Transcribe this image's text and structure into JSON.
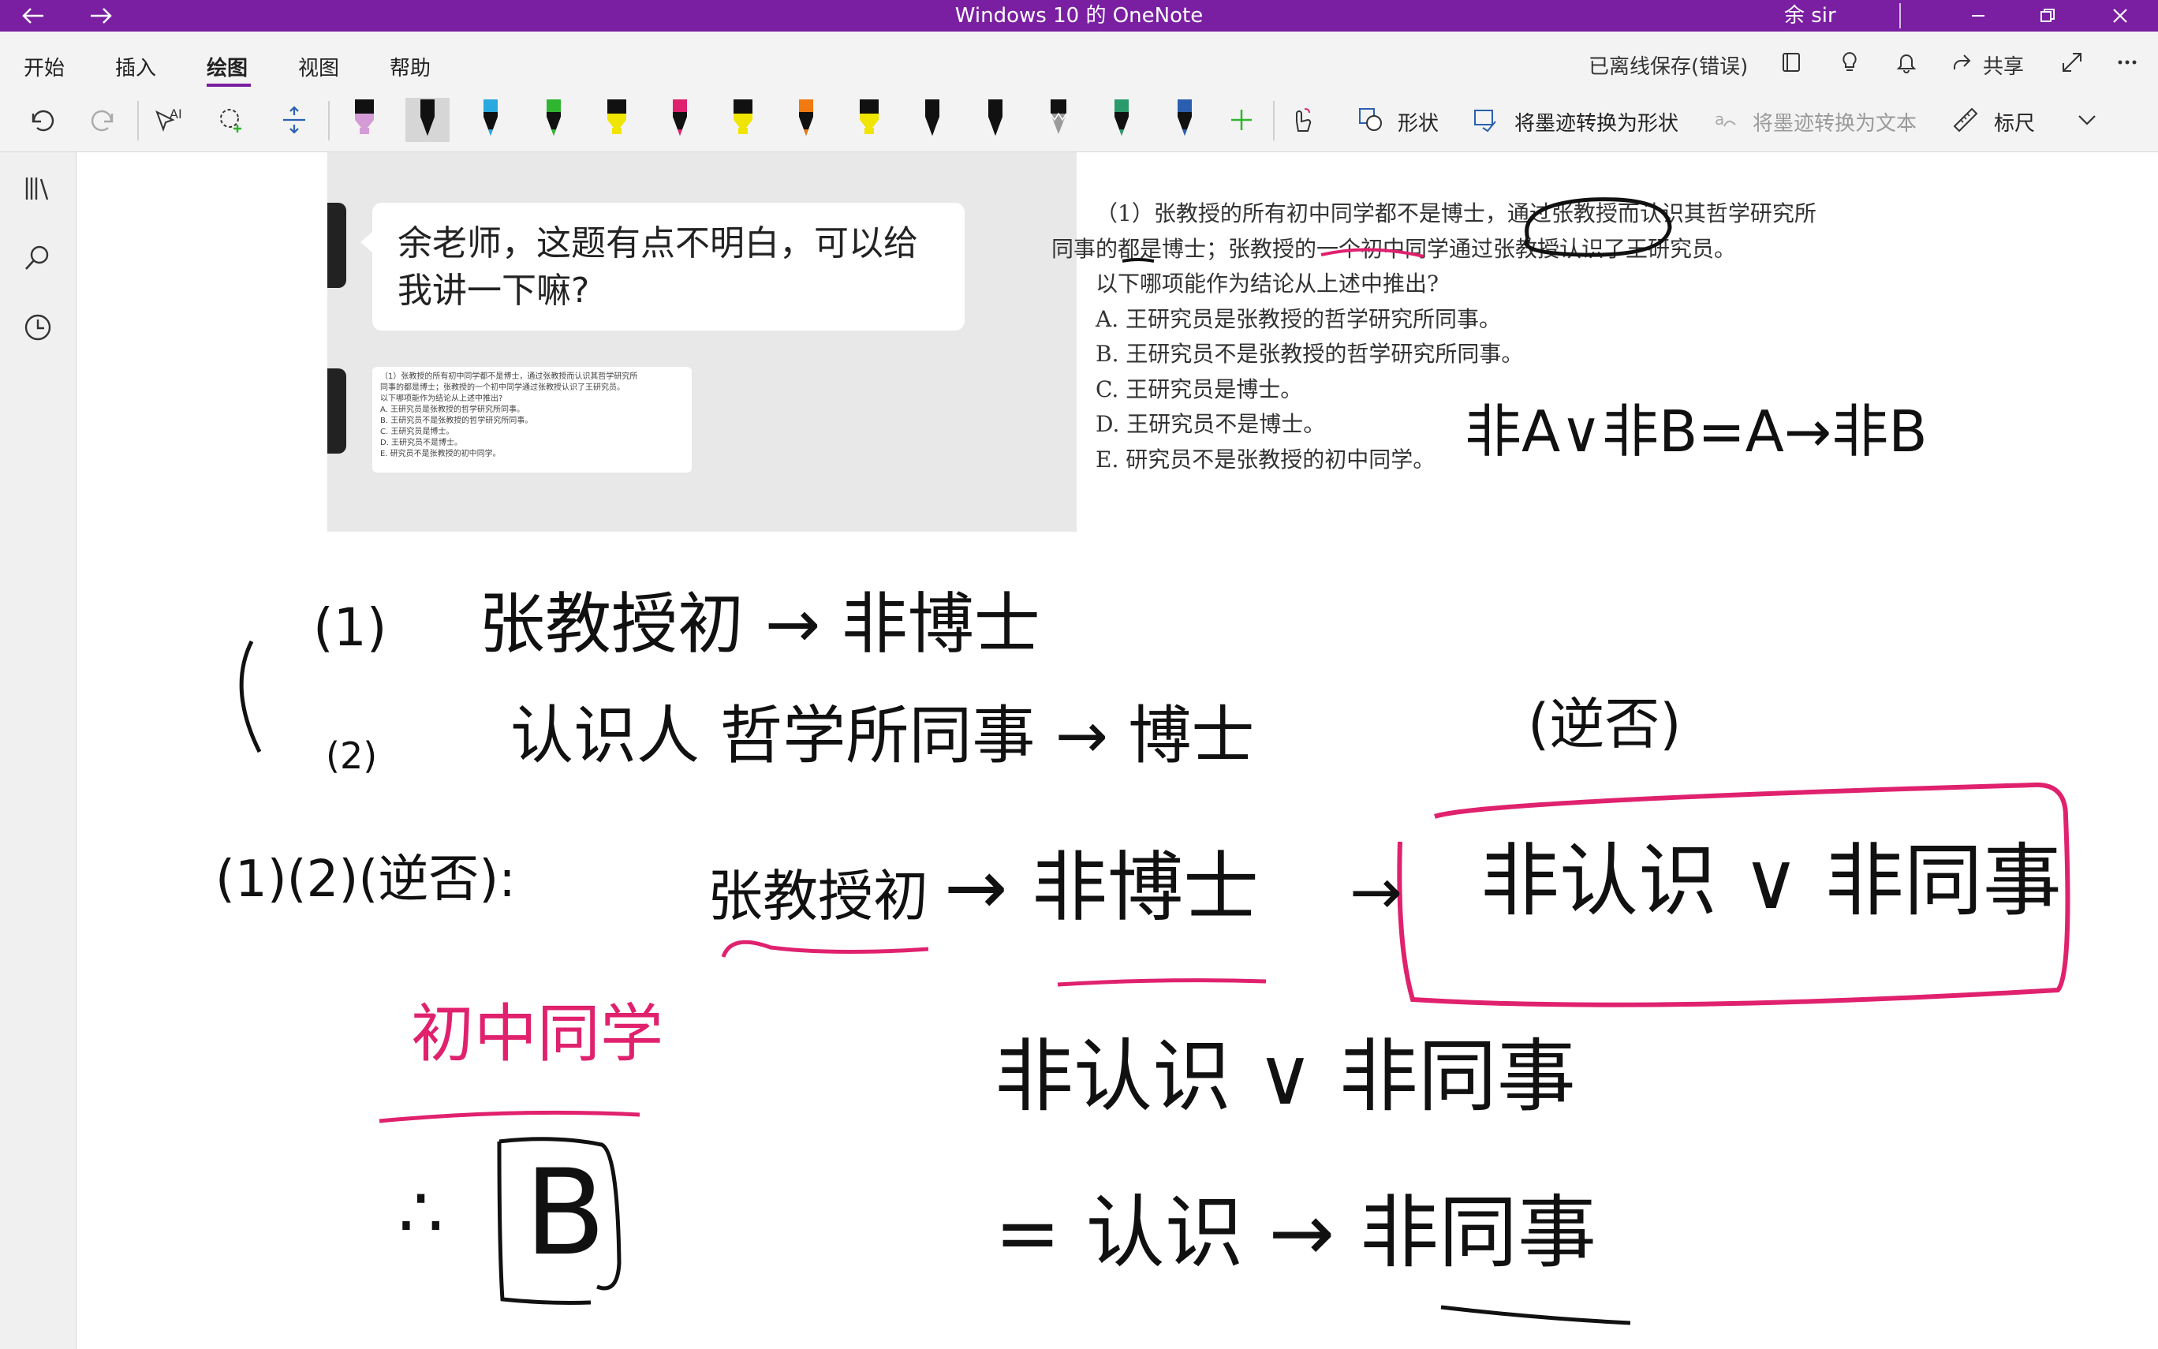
{
  "window": {
    "title": "Windows 10 的 OneNote",
    "user": "余 sir",
    "accent": "#7b1fa2"
  },
  "ribbon": {
    "tabs": [
      "开始",
      "插入",
      "绘图",
      "视图",
      "帮助"
    ],
    "active_tab": "绘图",
    "status": "已离线保存(错误)",
    "share_label": "共享"
  },
  "toolbar": {
    "shapes_label": "形状",
    "ink_to_shape_label": "将墨迹转换为形状",
    "ink_to_text_label": "将墨迹转换为文本",
    "ruler_label": "标尺",
    "pens": [
      {
        "color": "#d59bd6",
        "type": "highlighter"
      },
      {
        "color": "#111111",
        "type": "pen"
      },
      {
        "color": "#2aa8e0",
        "type": "pen"
      },
      {
        "color": "#2fb52f",
        "type": "pen"
      },
      {
        "color": "#f0e500",
        "type": "highlighter"
      },
      {
        "color": "#e0216e",
        "type": "pen"
      },
      {
        "color": "#f0e500",
        "type": "highlighter"
      },
      {
        "color": "#f07a10",
        "type": "pen"
      },
      {
        "color": "#f0e500",
        "type": "highlighter"
      },
      {
        "color": "#111111",
        "type": "pen"
      },
      {
        "color": "#111111",
        "type": "pen"
      },
      {
        "color": "#9a9a9a",
        "type": "pencil"
      },
      {
        "color": "#2a9a6a",
        "type": "pen"
      },
      {
        "color": "#2a5fb0",
        "type": "pen"
      }
    ]
  },
  "chat": {
    "message": "余老师，这题有点不明白，可以给我讲一下嘛?",
    "message_line1": "余老师，这题有点不明白，可以给",
    "message_line2": "我讲一下嘛?",
    "thumbnail_lines": [
      "（1）张教授的所有初中同学都不是博士，通过张教授而认识其哲学研究所",
      "同事的都是博士；张教授的一个初中同学通过张教授认识了王研究员。",
      "以下哪项能作为结论从上述中推出?",
      "A. 王研究员是张教授的哲学研究所同事。",
      "B. 王研究员不是张教授的哲学研究所同事。",
      "C. 王研究员是博士。",
      "D. 王研究员不是博士。",
      "E. 研究员不是张教授的初中同学。"
    ]
  },
  "question": {
    "lines": [
      "（1）张教授的所有初中同学都不是博士，通过张教授而认识其哲学研究所",
      "同事的都是博士；张教授的一个初中同学通过张教授认识了王研究员。",
      "以下哪项能作为结论从上述中推出?",
      "A. 王研究员是张教授的哲学研究所同事。",
      "B. 王研究员不是张教授的哲学研究所同事。",
      "C. 王研究员是博士。",
      "D. 王研究员不是博士。",
      "E. 研究员不是张教授的初中同学。"
    ]
  },
  "handwriting": {
    "formula": "非A∨非B=A→非B",
    "p1_label": "(1)",
    "p1_text": "张教授初 → 非博士",
    "p2_label": "(2)",
    "p2_text": "认识人 哲学所同事 → 博士",
    "p2_note": "(逆否)",
    "chain_label": "(1)(2)(逆否):",
    "chain_a": "张教授初",
    "chain_b": "→ 非博士",
    "chain_c": "→",
    "chain_box": "非认识 ∨ 非同事",
    "pink_label": "初中同学",
    "answer_prefix": "∴",
    "answer": "B",
    "eq1": "非认识 ∨ 非同事",
    "eq2": "= 认识 → 非同事",
    "ink_pink": "#e0216e",
    "ink_black": "#111111"
  }
}
